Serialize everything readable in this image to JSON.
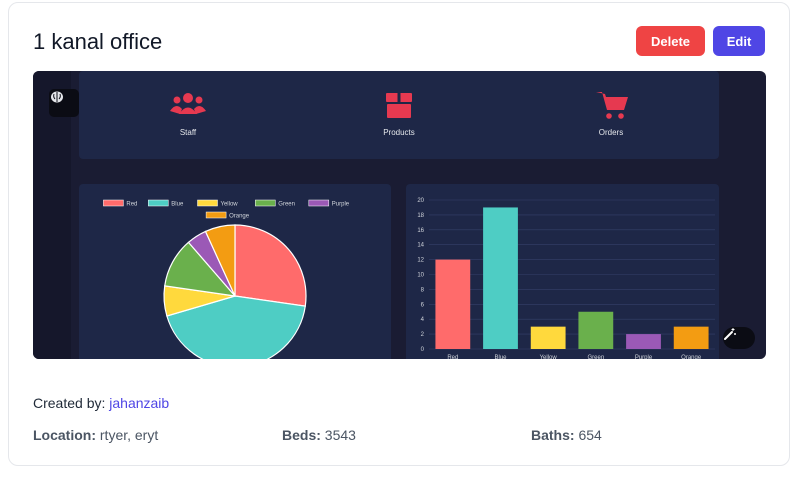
{
  "card": {
    "title": "1 kanal office",
    "delete_label": "Delete",
    "edit_label": "Edit",
    "colors": {
      "delete": "#ef4444",
      "edit": "#4f46e5",
      "link": "#4f46e5"
    }
  },
  "preview": {
    "stats": [
      {
        "label": "Staff",
        "icon": "users-icon"
      },
      {
        "label": "Products",
        "icon": "box-icon"
      },
      {
        "label": "Orders",
        "icon": "cart-icon"
      }
    ],
    "icons": {
      "top_left": "brain-icon",
      "bottom_right": "magic-wand-icon"
    }
  },
  "chart_data": [
    {
      "type": "pie",
      "categories": [
        "Red",
        "Blue",
        "Yellow",
        "Green",
        "Purple",
        "Orange"
      ],
      "values": [
        12,
        19,
        3,
        5,
        2,
        3
      ],
      "colors": [
        "#ff6b6b",
        "#4ecdc4",
        "#ffd93d",
        "#6ab04c",
        "#9b59b6",
        "#f39c12"
      ],
      "legend": "top"
    },
    {
      "type": "bar",
      "categories": [
        "Red",
        "Blue",
        "Yellow",
        "Green",
        "Purple",
        "Orange"
      ],
      "values": [
        12,
        19,
        3,
        5,
        2,
        3
      ],
      "colors": [
        "#ff6b6b",
        "#4ecdc4",
        "#ffd93d",
        "#6ab04c",
        "#9b59b6",
        "#f39c12"
      ],
      "ylim": [
        0,
        20
      ],
      "yticks": [
        0,
        2,
        4,
        6,
        8,
        10,
        12,
        14,
        16,
        18,
        20
      ],
      "grid": true
    }
  ],
  "details": {
    "created_prefix": "Created by:",
    "created_by": "jahanzaib",
    "location_label": "Location:",
    "location": "rtyer, eryt",
    "beds_label": "Beds:",
    "beds": "3543",
    "baths_label": "Baths:",
    "baths": "654"
  }
}
